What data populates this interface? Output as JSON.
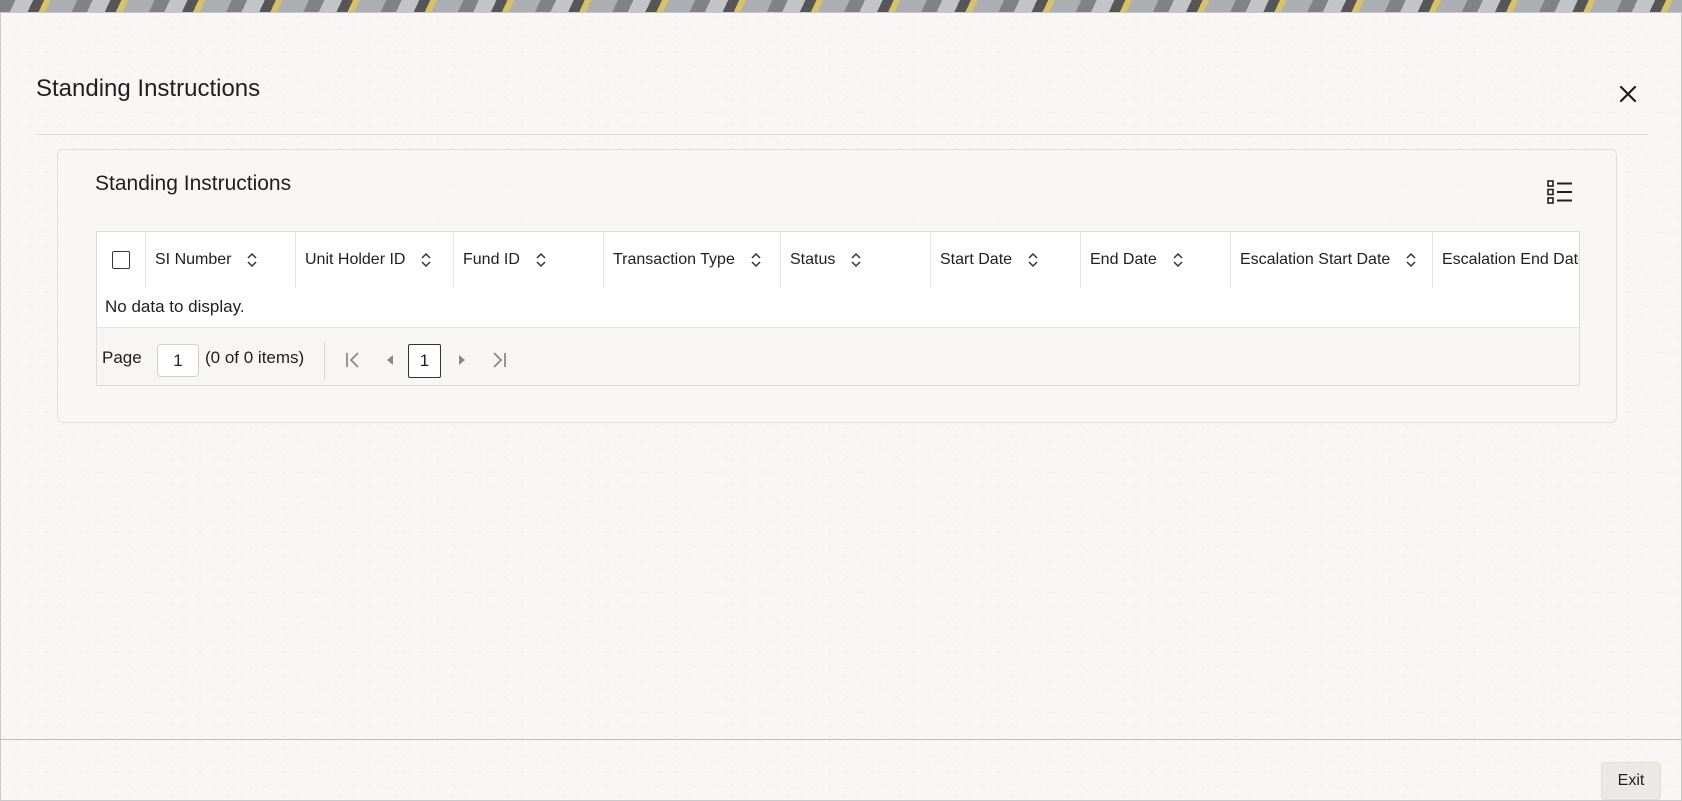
{
  "window": {
    "title": "Standing Instructions"
  },
  "panel": {
    "title": "Standing Instructions"
  },
  "table": {
    "columns": [
      {
        "label": "SI Number"
      },
      {
        "label": "Unit Holder ID"
      },
      {
        "label": "Fund ID"
      },
      {
        "label": "Transaction Type"
      },
      {
        "label": "Status"
      },
      {
        "label": "Start Date"
      },
      {
        "label": "End Date"
      },
      {
        "label": "Escalation Start Date"
      },
      {
        "label": "Escalation End Date"
      }
    ],
    "empty_message": "No data to display."
  },
  "pagination": {
    "page_label": "Page",
    "page_value": "1",
    "count_text": "(0 of 0 items)",
    "current_page": "1"
  },
  "footer": {
    "exit_label": "Exit"
  }
}
